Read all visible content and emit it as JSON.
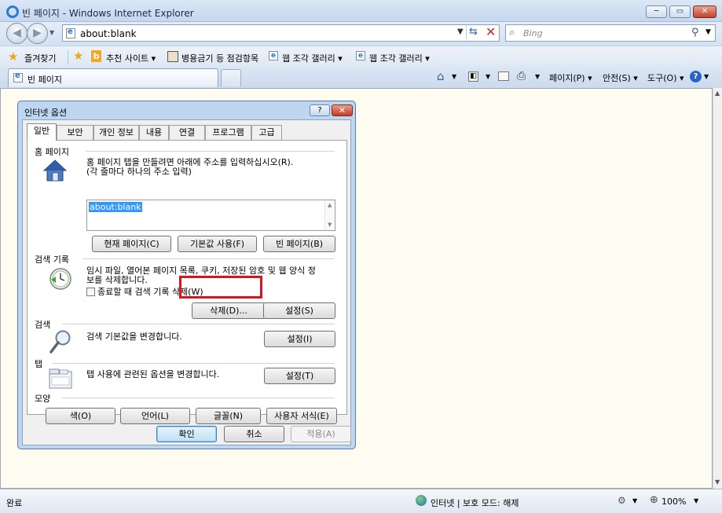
{
  "window": {
    "title": "빈 페이지 - Windows Internet Explorer",
    "min": "─",
    "max": "▭",
    "close": "✕"
  },
  "address": {
    "url": "about:blank",
    "search_placeholder": "Bing"
  },
  "favorites_bar": {
    "favorites": "즐겨찾기",
    "suggested": "추천 사이트 ▾",
    "item1": "병용금기 등 점검항목",
    "item2": "웹 조각 갤러리 ▾",
    "item3": "웹 조각 갤러리 ▾"
  },
  "tab": {
    "label": "빈 페이지"
  },
  "command_bar": {
    "page": "페이지(P) ▾",
    "safety": "안전(S) ▾",
    "tools": "도구(O) ▾"
  },
  "status_bar": {
    "left": "완료",
    "zone": "인터넷 | 보호 모드: 해제",
    "zoom": "100%"
  },
  "dialog": {
    "title": "인터넷 옵션",
    "help": "?",
    "close": "✕",
    "tabs": [
      "일반",
      "보안",
      "개인 정보",
      "내용",
      "연결",
      "프로그램",
      "고급"
    ],
    "home": {
      "header": "홈 페이지",
      "desc1": "홈 페이지 탭을 만들려면 아래에 주소를 입력하십시오(R).",
      "desc2": "(각 줄마다 하나의 주소 입력)",
      "value": "about:blank",
      "btn_current": "현재 페이지(C)",
      "btn_default": "기본값 사용(F)",
      "btn_blank": "빈 페이지(B)"
    },
    "history": {
      "header": "검색 기록",
      "desc1": "임시 파일, 열어본 페이지 목록, 쿠키, 저장된 암호 및 웹 양식 정",
      "desc2": "보를 삭제합니다.",
      "checkbox": "종료할 때 검색 기록 삭제(W)",
      "btn_delete": "삭제(D)...",
      "btn_settings": "설정(S)"
    },
    "search": {
      "header": "검색",
      "desc": "검색 기본값을 변경합니다.",
      "btn_settings": "설정(I)"
    },
    "tabs_section": {
      "header": "탭",
      "desc": "탭 사용에 관련된 옵션을 변경합니다.",
      "btn_settings": "설정(T)"
    },
    "appearance": {
      "header": "모양",
      "btn_colors": "색(O)",
      "btn_languages": "언어(L)",
      "btn_fonts": "글꼴(N)",
      "btn_accessibility": "사용자 서식(E)"
    },
    "ok": "확인",
    "cancel": "취소",
    "apply": "적용(A)"
  },
  "colors": {
    "highlight": "#e0101e",
    "selection": "#3399ff"
  }
}
